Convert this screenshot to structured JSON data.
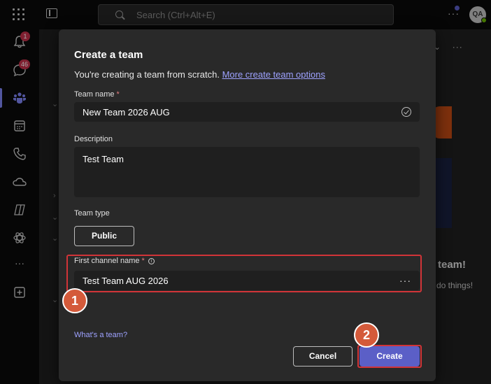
{
  "topbar": {
    "search_placeholder": "Search (Ctrl+Alt+E)",
    "more_label": "···",
    "avatar_initials": "QA"
  },
  "rail": {
    "items": [
      {
        "name": "activity",
        "icon": "bell-icon",
        "badge": "1"
      },
      {
        "name": "chat",
        "icon": "chat-icon",
        "badge": "46"
      },
      {
        "name": "teams",
        "icon": "teams-icon",
        "active": true
      },
      {
        "name": "calendar",
        "icon": "calendar-icon"
      },
      {
        "name": "calls",
        "icon": "phone-icon"
      },
      {
        "name": "onedrive",
        "icon": "cloud-icon"
      },
      {
        "name": "copilot",
        "icon": "copilot-icon"
      },
      {
        "name": "apps-ai",
        "icon": "atom-icon"
      },
      {
        "name": "more",
        "icon": "more-icon"
      },
      {
        "name": "add-apps",
        "icon": "plus-square-icon"
      }
    ],
    "more_label": "···"
  },
  "background": {
    "heading_fragment": "team!",
    "text_fragment": "do things!"
  },
  "dialog": {
    "title": "Create a team",
    "subtitle": "You're creating a team from scratch.",
    "subtitle_link": "More create team options",
    "team_name": {
      "label": "Team name",
      "required_mark": "*",
      "value": "New Team 2026 AUG"
    },
    "description": {
      "label": "Description",
      "value": "Test Team"
    },
    "team_type": {
      "label": "Team type",
      "value": "Public"
    },
    "first_channel": {
      "label": "First channel name",
      "required_mark": "*",
      "info_glyph": "i",
      "value": "Test Team AUG 2026",
      "more_label": "···"
    },
    "whats_a_team_link": "What's a team?",
    "cancel_label": "Cancel",
    "create_label": "Create"
  },
  "annotations": {
    "step1": "1",
    "step2": "2",
    "highlight_color": "#d13438",
    "step_color": "#d45a3a"
  },
  "colors": {
    "accent": "#5b5fc7",
    "link": "#9ea2ff",
    "dialog_bg": "#292929",
    "app_bg": "#0a0a0a"
  }
}
